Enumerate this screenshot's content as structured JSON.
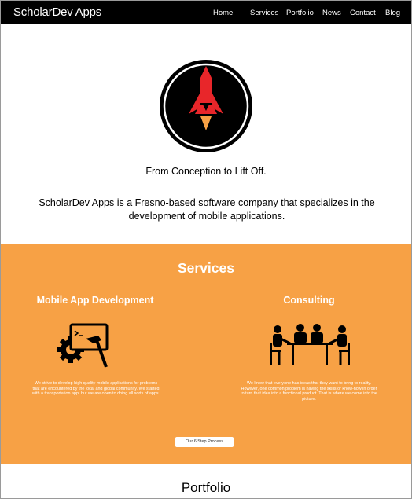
{
  "brand": "ScholarDev Apps",
  "nav": {
    "items": [
      {
        "label": "Home"
      },
      {
        "label": "Services"
      },
      {
        "label": "Portfolio"
      },
      {
        "label": "News"
      },
      {
        "label": "Contact"
      },
      {
        "label": "Blog"
      }
    ]
  },
  "hero": {
    "logo_icon": "rocket-icon",
    "tagline": "From Conception to Lift Off.",
    "intro": "ScholarDev Apps is a Fresno-based software company that specializes in the development of mobile applications."
  },
  "services": {
    "title": "Services",
    "items": [
      {
        "title": "Mobile App Development",
        "icon": "dev-tools-icon",
        "description": "We strive to develop high quality mobile applications for problems that are encountered by the local and global community. We started with a transportation app, but we are open to doing all sorts of apps."
      },
      {
        "title": "Consulting",
        "icon": "meeting-icon",
        "description": "We know that everyone has ideas that they want to bring to reality. However, one common problem is having the skills or know-how in order to turn that idea into a functional product. That is where we come into the picture."
      }
    ],
    "process_button": "Our 6 Step Process"
  },
  "portfolio": {
    "title": "Portfolio"
  },
  "colors": {
    "nav_bg": "#000000",
    "services_bg": "#f7a145",
    "rocket_red": "#e8262a",
    "flame_orange": "#f7a145"
  }
}
